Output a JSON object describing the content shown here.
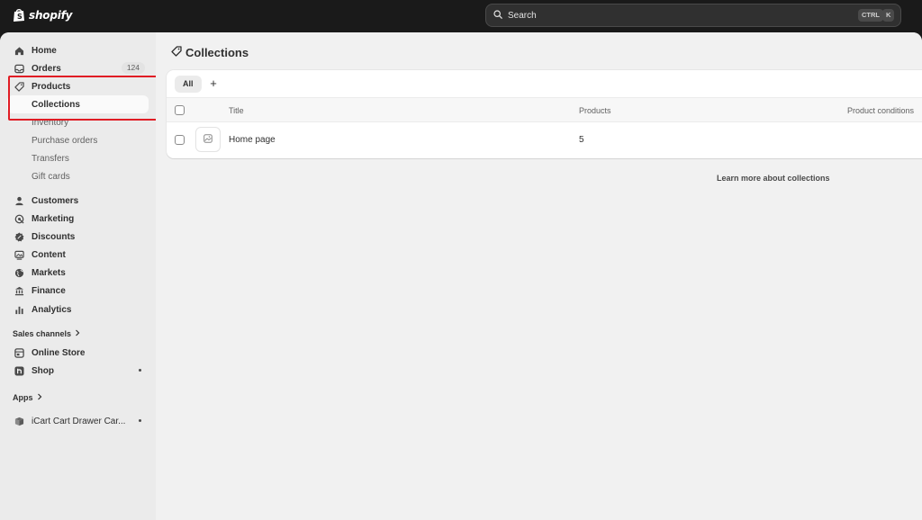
{
  "topbar": {
    "logo_text": "shopify",
    "search_placeholder": "Search",
    "shortcut_ctrl": "CTRL",
    "shortcut_k": "K"
  },
  "sidebar": {
    "home": "Home",
    "orders": "Orders",
    "orders_count": "124",
    "products": "Products",
    "collections": "Collections",
    "inventory": "Inventory",
    "purchase_orders": "Purchase orders",
    "transfers": "Transfers",
    "gift_cards": "Gift cards",
    "customers": "Customers",
    "marketing": "Marketing",
    "discounts": "Discounts",
    "content": "Content",
    "markets": "Markets",
    "finance": "Finance",
    "analytics": "Analytics",
    "sales_channels_label": "Sales channels",
    "online_store": "Online Store",
    "shop": "Shop",
    "apps_label": "Apps",
    "app_icart": "iCart Cart Drawer Car..."
  },
  "main": {
    "title": "Collections",
    "tab_all": "All",
    "tab_add": "+",
    "columns": {
      "title": "Title",
      "products": "Products",
      "conditions": "Product conditions"
    },
    "rows": [
      {
        "title": "Home page",
        "products": "5",
        "conditions": ""
      }
    ],
    "learn_more": "Learn more about collections"
  },
  "colors": {
    "topbar_bg": "#1a1a1a",
    "sidebar_bg": "#ebebeb",
    "main_bg": "#f1f1f1",
    "highlight": "#e01c24"
  }
}
